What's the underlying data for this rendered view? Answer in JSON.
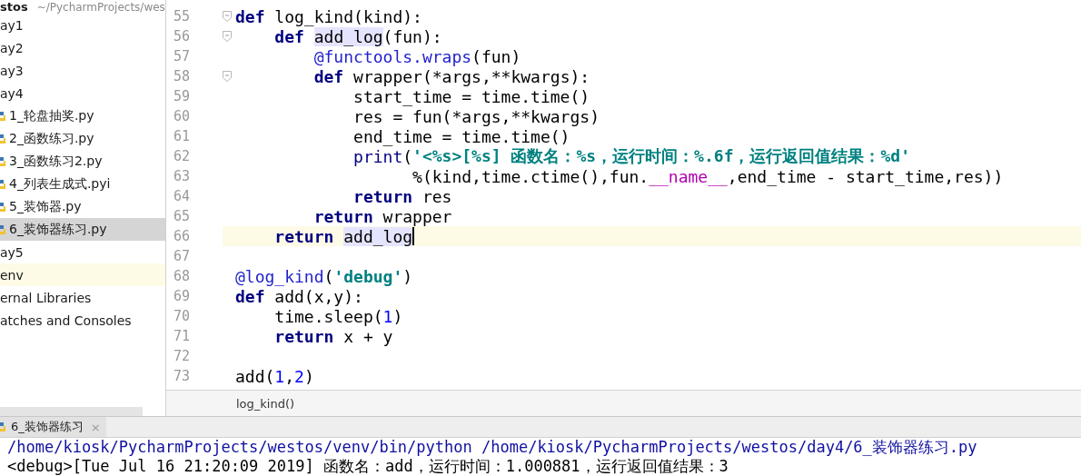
{
  "project_tree": {
    "root": {
      "name": "stos",
      "path": "~/PycharmProjects/wes"
    },
    "items": [
      {
        "label": "ay1",
        "kind": "folder",
        "selected": false
      },
      {
        "label": "ay2",
        "kind": "folder",
        "selected": false
      },
      {
        "label": "ay3",
        "kind": "folder",
        "selected": false
      },
      {
        "label": "ay4",
        "kind": "folder",
        "selected": false,
        "children": [
          {
            "label": "1_轮盘抽奖.py",
            "kind": "python",
            "selected": false
          },
          {
            "label": "2_函数练习.py",
            "kind": "python",
            "selected": false
          },
          {
            "label": "3_函数练习2.py",
            "kind": "python",
            "selected": false
          },
          {
            "label": "4_列表生成式.pyi",
            "kind": "python",
            "selected": false
          },
          {
            "label": "5_装饰器.py",
            "kind": "python",
            "selected": false
          },
          {
            "label": "6_装饰器练习.py",
            "kind": "python",
            "selected": true
          }
        ]
      },
      {
        "label": "ay5",
        "kind": "folder",
        "selected": false
      },
      {
        "label": "env",
        "kind": "excluded",
        "selected": false
      },
      {
        "label": "ernal Libraries",
        "kind": "folder",
        "selected": false
      },
      {
        "label": "atches and Consoles",
        "kind": "folder",
        "selected": false
      }
    ]
  },
  "editor": {
    "lines": [
      {
        "number": "55",
        "fold": true,
        "current": false,
        "tokens": [
          {
            "kind": "kw",
            "text": "def"
          },
          {
            "kind": "plain",
            "text": " log_kind(kind):"
          }
        ]
      },
      {
        "number": "56",
        "fold": true,
        "current": false,
        "tokens": [
          {
            "kind": "kw",
            "text": "    def "
          },
          {
            "kind": "hl",
            "text": "add_log"
          },
          {
            "kind": "plain",
            "text": "(fun):"
          }
        ]
      },
      {
        "number": "57",
        "fold": false,
        "current": false,
        "tokens": [
          {
            "kind": "deco",
            "text": "        @functools.wraps"
          },
          {
            "kind": "plain",
            "text": "(fun)"
          }
        ]
      },
      {
        "number": "58",
        "fold": true,
        "current": false,
        "tokens": [
          {
            "kind": "kw",
            "text": "        def"
          },
          {
            "kind": "plain",
            "text": " wrapper(*args,**kwargs):"
          }
        ]
      },
      {
        "number": "59",
        "fold": false,
        "current": false,
        "tokens": [
          {
            "kind": "plain",
            "text": "            start_time = time.time()"
          }
        ]
      },
      {
        "number": "60",
        "fold": false,
        "current": false,
        "tokens": [
          {
            "kind": "plain",
            "text": "            res = fun(*args,**kwargs)"
          }
        ]
      },
      {
        "number": "61",
        "fold": false,
        "current": false,
        "tokens": [
          {
            "kind": "plain",
            "text": "            end_time = time.time()"
          }
        ]
      },
      {
        "number": "62",
        "fold": false,
        "current": false,
        "tokens": [
          {
            "kind": "builtin",
            "text": "            print"
          },
          {
            "kind": "plain",
            "text": "("
          },
          {
            "kind": "str",
            "text": "'<%s>[%s] 函数名：%s，运行时间：%.6f，运行返回值结果：%d'"
          }
        ]
      },
      {
        "number": "63",
        "fold": false,
        "current": false,
        "tokens": [
          {
            "kind": "plain",
            "text": "                  %(kind,time.ctime(),fun."
          },
          {
            "kind": "magic",
            "text": "__name__"
          },
          {
            "kind": "plain",
            "text": ",end_time - start_time,res))"
          }
        ]
      },
      {
        "number": "64",
        "fold": false,
        "current": false,
        "tokens": [
          {
            "kind": "kw",
            "text": "            return"
          },
          {
            "kind": "plain",
            "text": " res"
          }
        ]
      },
      {
        "number": "65",
        "fold": false,
        "current": false,
        "tokens": [
          {
            "kind": "kw",
            "text": "        return"
          },
          {
            "kind": "plain",
            "text": " wrapper"
          }
        ]
      },
      {
        "number": "66",
        "fold": false,
        "current": true,
        "tokens": [
          {
            "kind": "kw",
            "text": "    return "
          },
          {
            "kind": "hl",
            "text": "add_log"
          }
        ]
      },
      {
        "number": "67",
        "fold": false,
        "current": false
      },
      {
        "number": "68",
        "fold": false,
        "current": false,
        "tokens": [
          {
            "kind": "deco",
            "text": "@log_kind"
          },
          {
            "kind": "plain",
            "text": "("
          },
          {
            "kind": "str",
            "text": "'debug'"
          },
          {
            "kind": "plain",
            "text": ")"
          }
        ]
      },
      {
        "number": "69",
        "fold": false,
        "current": false,
        "tokens": [
          {
            "kind": "kw",
            "text": "def"
          },
          {
            "kind": "plain",
            "text": " add(x,y):"
          }
        ]
      },
      {
        "number": "70",
        "fold": false,
        "current": false,
        "tokens": [
          {
            "kind": "plain",
            "text": "    time.sleep("
          },
          {
            "kind": "num",
            "text": "1"
          },
          {
            "kind": "plain",
            "text": ")"
          }
        ]
      },
      {
        "number": "71",
        "fold": false,
        "current": false,
        "tokens": [
          {
            "kind": "kw",
            "text": "    return"
          },
          {
            "kind": "plain",
            "text": " x + y"
          }
        ]
      },
      {
        "number": "72",
        "fold": false,
        "current": false
      },
      {
        "number": "73",
        "fold": false,
        "current": false,
        "tokens": [
          {
            "kind": "plain",
            "text": "add("
          },
          {
            "kind": "num",
            "text": "1"
          },
          {
            "kind": "plain",
            "text": ","
          },
          {
            "kind": "num",
            "text": "2"
          },
          {
            "kind": "plain",
            "text": ")"
          }
        ]
      }
    ],
    "breadcrumb": "log_kind()"
  },
  "run_panel": {
    "tab": {
      "label": "6_装饰器练习",
      "close": "×"
    },
    "output": [
      {
        "kind": "command",
        "text": "/home/kiosk/PycharmProjects/westos/venv/bin/python /home/kiosk/PycharmProjects/westos/day4/6_装饰器练习.py"
      },
      {
        "kind": "stdout",
        "text": "<debug>[Tue Jul 16 21:20:09 2019] 函数名：add，运行时间：1.000881，运行返回值结果：3"
      }
    ]
  }
}
